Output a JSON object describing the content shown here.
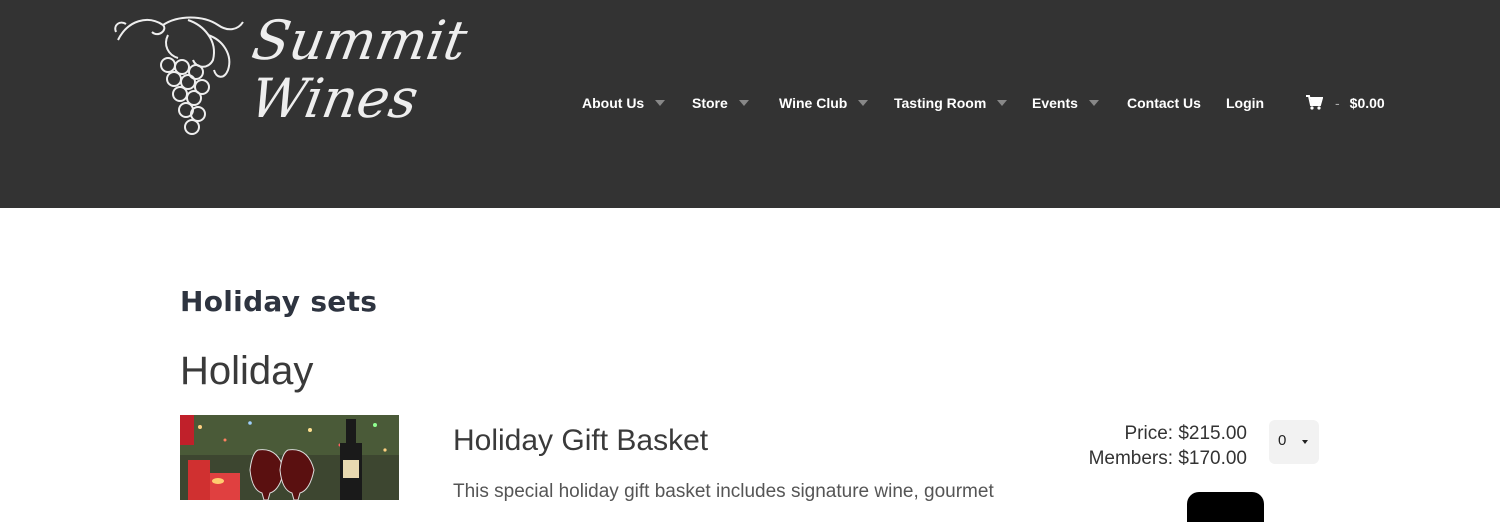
{
  "header": {
    "logo": {
      "line1": "Summit",
      "line2": "Wines",
      "icon": "grape-vine-icon"
    },
    "nav": [
      {
        "label": "About Us",
        "dropdown": true
      },
      {
        "label": "Store",
        "dropdown": true
      },
      {
        "label": "Wine Club",
        "dropdown": true
      },
      {
        "label": "Tasting Room",
        "dropdown": true
      },
      {
        "label": "Events",
        "dropdown": true
      },
      {
        "label": "Contact Us",
        "dropdown": false
      },
      {
        "label": "Login",
        "dropdown": false
      }
    ],
    "cart": {
      "icon": "shopping-cart-icon",
      "separator": "-",
      "total": "$0.00"
    }
  },
  "main": {
    "section_title": "Holiday sets",
    "category_title": "Holiday",
    "product": {
      "name": "Holiday Gift Basket",
      "description": "This special holiday gift basket includes signature wine, gourmet",
      "price_label": "Price: $215.00",
      "members_label": "Members: $170.00",
      "quantity": "0"
    }
  },
  "colors": {
    "header_bg": "#333333",
    "nav_text": "#ffffff",
    "caret": "#888888",
    "button_bg": "#000000"
  }
}
